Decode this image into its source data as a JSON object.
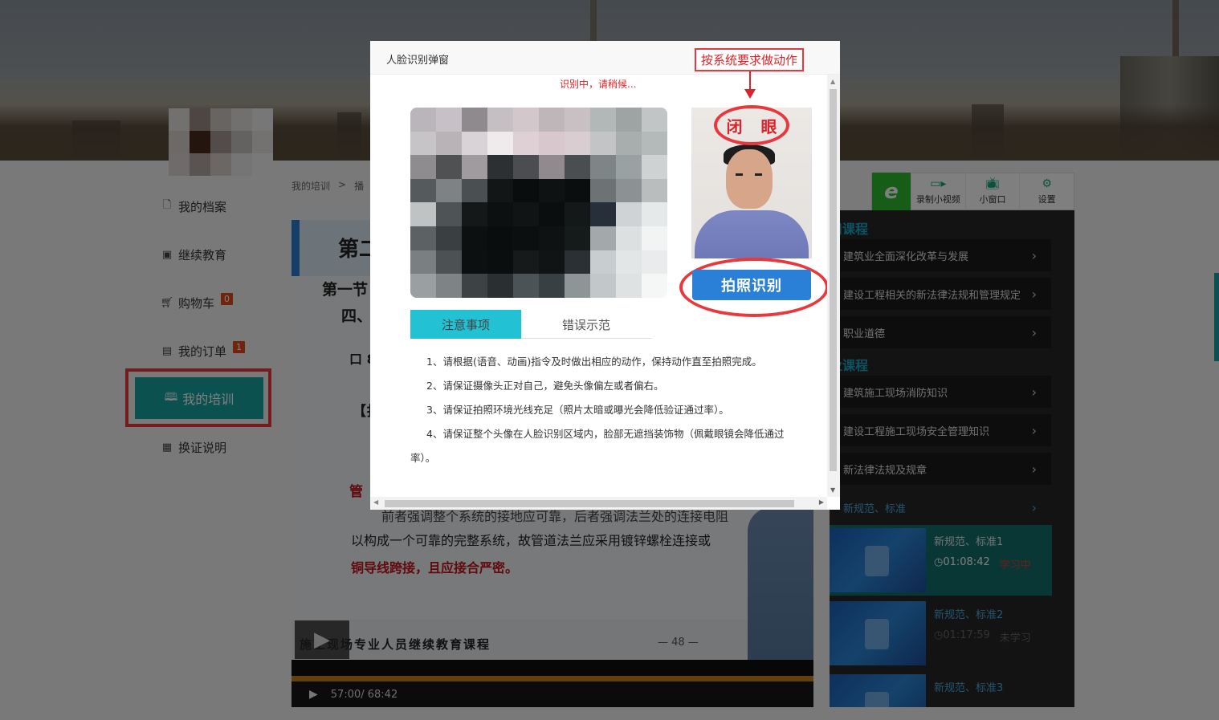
{
  "nav": {
    "items": [
      {
        "label": "我的档案",
        "icon": "file-icon"
      },
      {
        "label": "继续教育",
        "icon": "monitor-icon"
      },
      {
        "label": "购物车",
        "icon": "cart-icon",
        "badge": "0"
      },
      {
        "label": "我的订单",
        "icon": "order-icon",
        "badge": "1"
      },
      {
        "label": "我的培训",
        "icon": "book-icon",
        "active": true
      },
      {
        "label": "换证说明",
        "icon": "calendar-icon"
      }
    ]
  },
  "breadcrumb": {
    "root": "我的培训",
    "sep": ">",
    "current": "播"
  },
  "video": {
    "slide_title": "第二",
    "slide_line1": "第一节",
    "slide_line2": "四、",
    "slide_line3": "口 8",
    "slide_line4": "【扌",
    "slide_red1": "管",
    "slide_body1": "前者强调整个系统的接地应可靠，后者强调法兰处的连接电阻",
    "slide_body2": "以构成一个可靠的完整系统，故管道法兰应采用镀锌螺栓连接或",
    "slide_red2": "铜导线跨接，且应接合严密。",
    "slide_footer": "施工现场专业人员继续教育课程",
    "slide_page": "— 48 —",
    "time": "57:00/ 68:42",
    "progress": 0.83
  },
  "toolbar": {
    "logo": "e",
    "tools": [
      {
        "label": "录制小视频",
        "icon": "video-camera-icon"
      },
      {
        "label": "小窗口",
        "icon": "tv-icon"
      },
      {
        "label": "设置",
        "icon": "gear-icon"
      }
    ]
  },
  "panel": {
    "section1": "用课程",
    "section2": "业课程",
    "courses1": [
      "建筑业全面深化改革与发展",
      "建设工程相关的新法律法规和管理规定",
      "职业道德"
    ],
    "courses2": [
      "建筑施工现场消防知识",
      "建设工程施工现场安全管理知识",
      "新法律法规及规章",
      "新规范、标准"
    ],
    "lessons": [
      {
        "title": "新规范、标准1",
        "duration": "01:08:42",
        "status": "学习中"
      },
      {
        "title": "新规范、标准2",
        "duration": "01:17:59",
        "status": "未学习"
      },
      {
        "title": "新规范、标准3",
        "duration": "",
        "status": ""
      }
    ]
  },
  "modal": {
    "title": "人脸识别弹窗",
    "status": "识别中，请稍候...",
    "annotation": "按系统要求做动作",
    "action_label": "闭 眼",
    "shoot_button": "拍照识别",
    "tabs": [
      "注意事项",
      "错误示范"
    ],
    "notes": [
      "1、请根据(语音、动画)指令及时做出相应的动作，保持动作直至拍照完成。",
      "2、请保证摄像头正对自己，避免头像偏左或者偏右。",
      "3、请保证拍照环境光线充足（照片太暗或曝光会降低验证通过率）。",
      "4、请保证整个头像在人脸识别区域内，脸部无遮挡装饰物（佩戴眼镜会降低通过率）。"
    ]
  },
  "colors": {
    "accent": "#17a3a0",
    "alert": "#e8383d",
    "button": "#2a7fd6"
  }
}
